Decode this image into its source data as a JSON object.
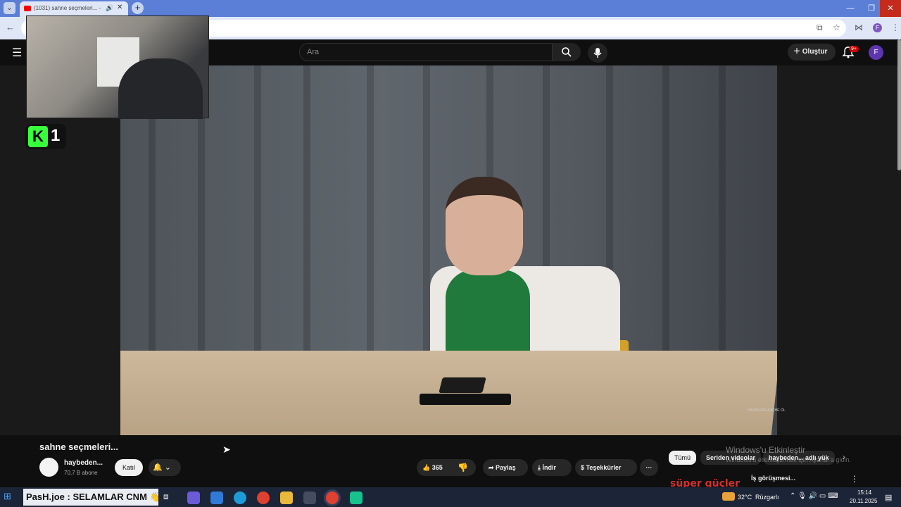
{
  "browser": {
    "tab_title": "(1031) sahne seçmeleri... - Yo",
    "tab_search_glyph": "⌄",
    "new_tab_glyph": "+",
    "back_glyph": "←",
    "window_controls": {
      "minimize": "—",
      "restore": "❐",
      "close": "✕"
    }
  },
  "youtube": {
    "search_placeholder": "Ara",
    "create_label": "Oluştur",
    "notification_count": "9+",
    "avatar_letter": "F"
  },
  "overlay": {
    "k_letter": "K",
    "k_number": "1"
  },
  "video": {
    "title": "sahne seçmeleri...",
    "channel_name": "haybeden...",
    "subscribers": "70,7 B abone",
    "join_label": "Katıl",
    "likes": "365",
    "share_label": "Paylaş",
    "download_label": "İndir",
    "thanks_label": "Teşekkürler",
    "more_label": "···",
    "watermark": "HAYBEDEN ASCHE OL"
  },
  "recommendations": {
    "filters": [
      "Tümü",
      "Seriden videolar",
      "haybeden... adlı yük"
    ],
    "item_title": "İş görüşmesi...",
    "item_thumb_text": "süper güçler"
  },
  "windows_activation": {
    "title": "Windows'u Etkinleştir",
    "subtitle": "Windows'u etkinleştirmek için Ayarlar'a gidin."
  },
  "taskbar": {
    "chat_overlay": "PasH.joe : SELAMLAR CNM 👋",
    "weather_temp": "32°C",
    "weather_desc": "Rüzgarlı",
    "time": "15:14",
    "date": "20.11.2025"
  },
  "colors": {
    "youtube_red": "#ff0000",
    "accent_green": "#37ff3b",
    "browser_tabstrip": "#5b7fd6"
  }
}
